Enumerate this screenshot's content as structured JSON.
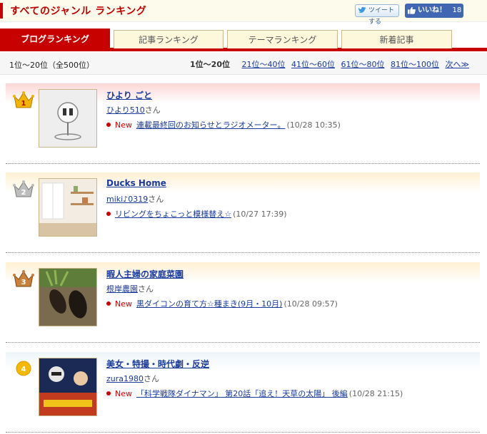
{
  "header": {
    "title": "すべてのジャンル  ランキング",
    "tweet_label": "ツイートする",
    "like_label": "いいね！",
    "like_count": "18"
  },
  "tabs": [
    {
      "label": "ブログランキング",
      "active": true
    },
    {
      "label": "記事ランキング",
      "active": false
    },
    {
      "label": "テーマランキング",
      "active": false
    },
    {
      "label": "新着記事",
      "active": false
    }
  ],
  "pager": {
    "range_total": "1位～20位（全500位）",
    "current": "1位～20位",
    "links": [
      "21位～40位",
      "41位～60位",
      "61位～80位",
      "81位～100位",
      "次へ≫"
    ]
  },
  "entries": [
    {
      "rank": "1",
      "blog_name": "ひより ごと",
      "author": "ひより510",
      "suffix": "さん",
      "is_new": true,
      "new_label": "New",
      "post_title": "連載最終回のお知らせとラジオメーター。",
      "post_time": "(10/28 10:35)"
    },
    {
      "rank": "2",
      "blog_name": "Ducks Home",
      "author": "miki♪0319",
      "suffix": "さん",
      "is_new": false,
      "new_label": "",
      "post_title": "リビングをちょこっと模様替え☆",
      "post_time": "(10/27 17:39)"
    },
    {
      "rank": "3",
      "blog_name": "暇人主婦の家庭菜園",
      "author": "根岸農園",
      "suffix": "さん",
      "is_new": true,
      "new_label": "New",
      "post_title": "黒ダイコンの育て方☆種まき(9月・10月)",
      "post_time": "(10/28 09:57)"
    },
    {
      "rank": "4",
      "blog_name": "美女・特撮・時代劇・反逆",
      "author": "zura1980",
      "suffix": "さん",
      "is_new": true,
      "new_label": "New",
      "post_title": "「科学戦隊ダイナマン」 第20話「追え！天草の太陽」 後編",
      "post_time": "(10/28 21:15)"
    }
  ],
  "colors": {
    "brand_red": "#c70000",
    "band_1": "#fde0e0",
    "band_2": "#fff4dd",
    "band_3": "#fff4dd",
    "band_4": "#f2f8fb",
    "gold": "#e0a400",
    "silver": "#9a9a9a",
    "bronze": "#b96a2a"
  }
}
